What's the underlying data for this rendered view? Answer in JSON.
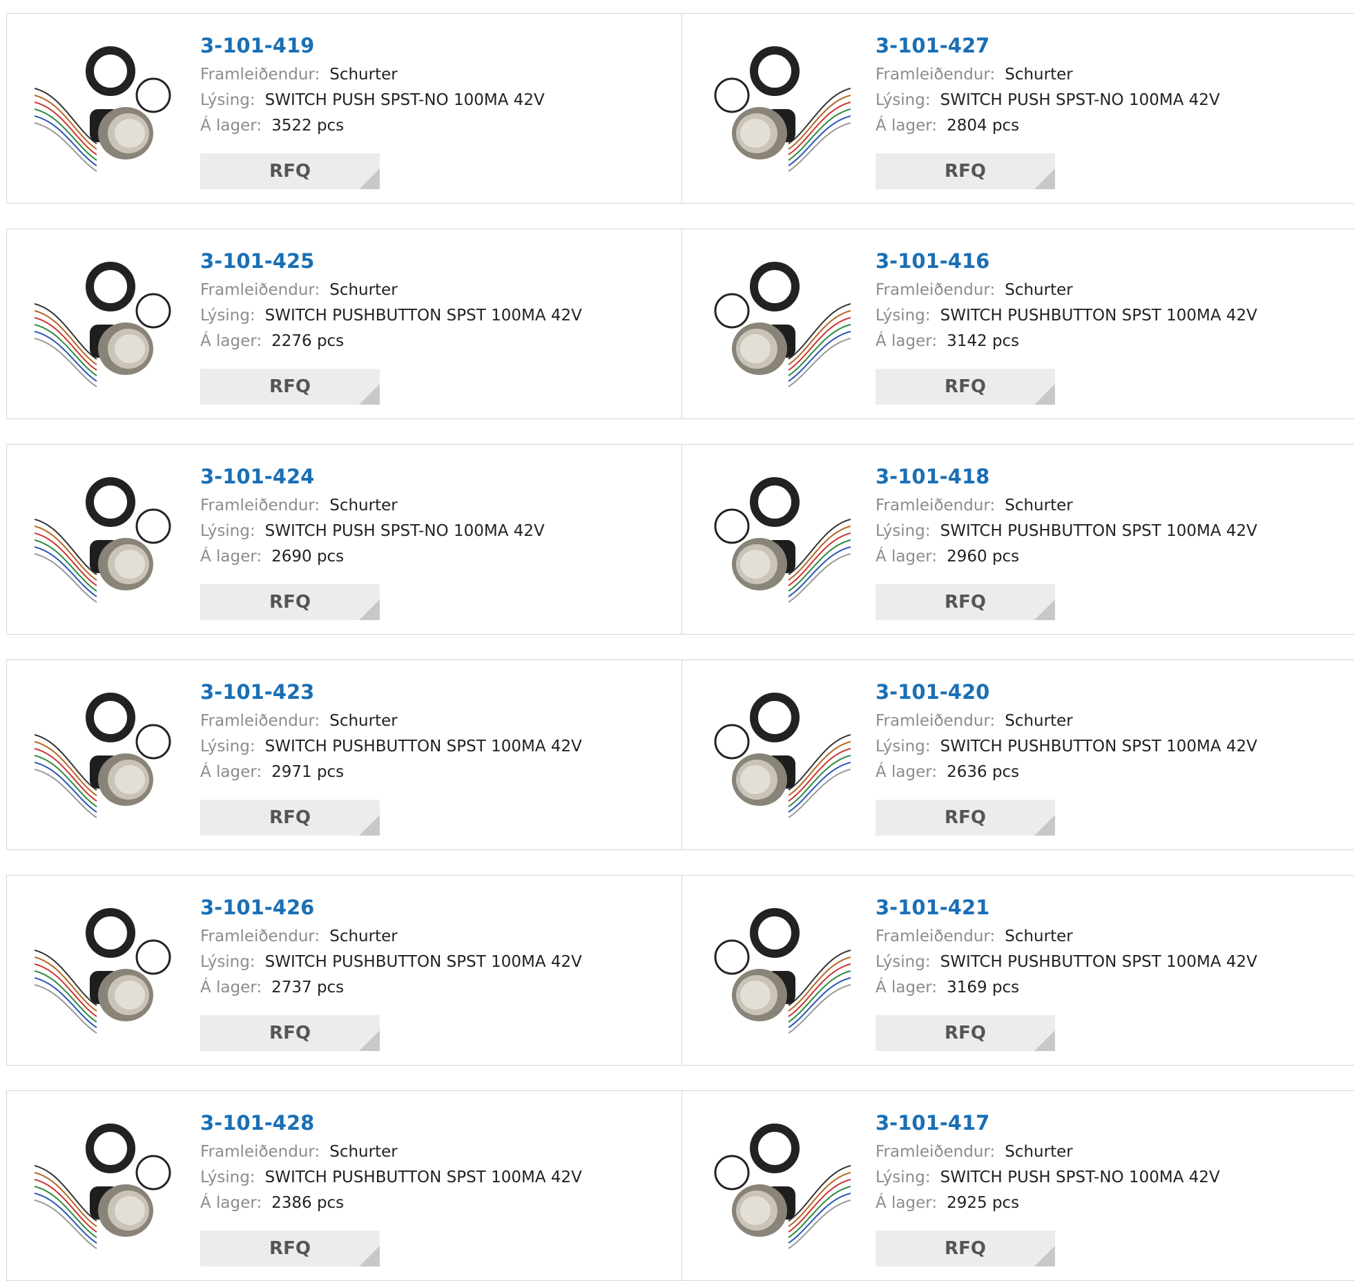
{
  "labels": {
    "manufacturer": "Framleiðendur:",
    "description": "Lýsing:",
    "stock": "Á lager:",
    "rfq": "RFQ"
  },
  "colors": {
    "part_number": "#1a6fb5",
    "label": "#8c8c8c",
    "value": "#222222",
    "rfq_bg": "#ececec",
    "rfq_text": "#555555",
    "border": "#d5d5d5"
  },
  "products": [
    {
      "part_number": "3-101-419",
      "manufacturer": "Schurter",
      "description": "SWITCH PUSH SPST-NO 100MA 42V",
      "stock": "3522 pcs",
      "image": "pushbutton-switch-with-wires-and-nut"
    },
    {
      "part_number": "3-101-427",
      "manufacturer": "Schurter",
      "description": "SWITCH PUSH SPST-NO 100MA 42V",
      "stock": "2804 pcs",
      "image": "pushbutton-switch-with-wires-and-nut"
    },
    {
      "part_number": "3-101-425",
      "manufacturer": "Schurter",
      "description": "SWITCH PUSHBUTTON SPST 100MA 42V",
      "stock": "2276 pcs",
      "image": "pushbutton-switch-with-wires-and-nut"
    },
    {
      "part_number": "3-101-416",
      "manufacturer": "Schurter",
      "description": "SWITCH PUSHBUTTON SPST 100MA 42V",
      "stock": "3142 pcs",
      "image": "pushbutton-switch-with-wires-and-nut"
    },
    {
      "part_number": "3-101-424",
      "manufacturer": "Schurter",
      "description": "SWITCH PUSH SPST-NO 100MA 42V",
      "stock": "2690 pcs",
      "image": "pushbutton-switch-with-wires-and-nut"
    },
    {
      "part_number": "3-101-418",
      "manufacturer": "Schurter",
      "description": "SWITCH PUSHBUTTON SPST 100MA 42V",
      "stock": "2960 pcs",
      "image": "pushbutton-switch-with-wires-and-nut"
    },
    {
      "part_number": "3-101-423",
      "manufacturer": "Schurter",
      "description": "SWITCH PUSHBUTTON SPST 100MA 42V",
      "stock": "2971 pcs",
      "image": "pushbutton-switch-with-wires-and-nut"
    },
    {
      "part_number": "3-101-420",
      "manufacturer": "Schurter",
      "description": "SWITCH PUSHBUTTON SPST 100MA 42V",
      "stock": "2636 pcs",
      "image": "pushbutton-switch-with-wires-and-nut"
    },
    {
      "part_number": "3-101-426",
      "manufacturer": "Schurter",
      "description": "SWITCH PUSHBUTTON SPST 100MA 42V",
      "stock": "2737 pcs",
      "image": "pushbutton-switch-with-wires-and-nut"
    },
    {
      "part_number": "3-101-421",
      "manufacturer": "Schurter",
      "description": "SWITCH PUSHBUTTON SPST 100MA 42V",
      "stock": "3169 pcs",
      "image": "pushbutton-switch-with-wires-and-nut"
    },
    {
      "part_number": "3-101-428",
      "manufacturer": "Schurter",
      "description": "SWITCH PUSHBUTTON SPST 100MA 42V",
      "stock": "2386 pcs",
      "image": "pushbutton-switch-with-wires-and-nut"
    },
    {
      "part_number": "3-101-417",
      "manufacturer": "Schurter",
      "description": "SWITCH PUSH SPST-NO 100MA 42V",
      "stock": "2925 pcs",
      "image": "pushbutton-switch-with-wires-and-nut"
    }
  ]
}
